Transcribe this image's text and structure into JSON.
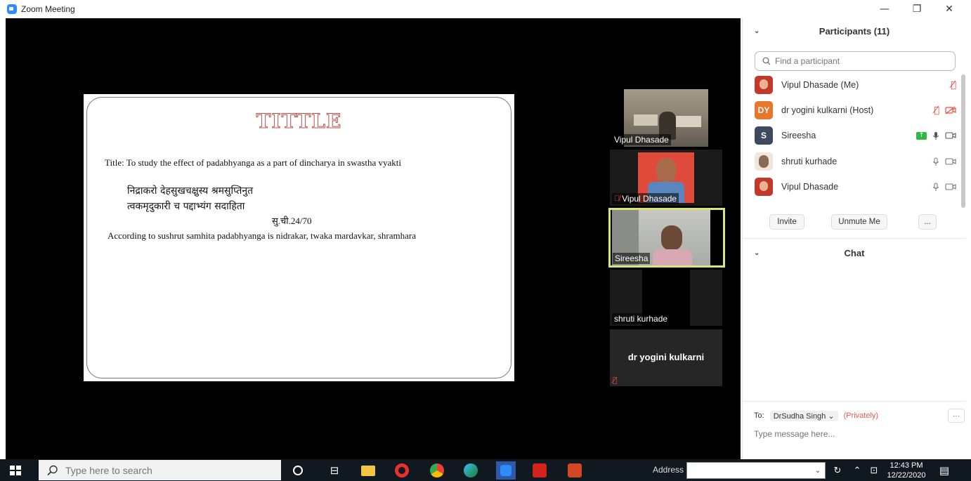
{
  "window": {
    "title": "Zoom Meeting",
    "minimize": "—",
    "restore": "❐",
    "close": "✕"
  },
  "slide": {
    "heading": "TITTLE",
    "line1": "Title: To study the effect of padabhyanga as a part of dincharya in swastha vyakti",
    "verse1": "निद्राकरो देहसुखचक्षुस्य श्रमसुप्तिनुत",
    "verse2": "त्वकमृदुकारी च पद्दाभ्यंग सदाहिता",
    "reference": "सु.ची.24/70",
    "line2": "According to sushrut samhita padabhyanga is nidrakar, twaka mardavkar, shramhara"
  },
  "video_tiles": [
    {
      "name": "Vipul Dhasade",
      "muted": false,
      "active": false
    },
    {
      "name": "Vipul Dhasade",
      "muted": true,
      "active": false
    },
    {
      "name": "Sireesha",
      "muted": false,
      "active": true
    },
    {
      "name": "shruti kurhade",
      "muted": false,
      "active": false
    },
    {
      "name": "dr yogini kulkarni",
      "muted": true,
      "active": false
    }
  ],
  "participants_panel": {
    "title": "Participants (11)",
    "search_placeholder": "Find a participant",
    "participants": [
      {
        "name": "Vipul Dhasade (Me)",
        "initials": "",
        "avatar_color": "#c0392b",
        "mic": "muted",
        "video": "none"
      },
      {
        "name": "dr yogini kulkarni (Host)",
        "initials": "DY",
        "avatar_color": "#e8772e",
        "mic": "muted",
        "video": "off"
      },
      {
        "name": "Sireesha",
        "initials": "S",
        "avatar_color": "#3b4a5c",
        "mic": "on",
        "video": "on",
        "share": true
      },
      {
        "name": "shruti kurhade",
        "initials": "",
        "avatar_color": "#8a6a50",
        "mic": "on",
        "video": "on"
      },
      {
        "name": "Vipul Dhasade",
        "initials": "",
        "avatar_color": "#c0392b",
        "mic": "on",
        "video": "on"
      }
    ],
    "buttons": {
      "invite": "Invite",
      "unmute": "Unmute Me",
      "more": "..."
    }
  },
  "chat": {
    "title": "Chat",
    "to_label": "To:",
    "recipient": "DrSudha Singh",
    "privately": "(Privately)",
    "more": "···",
    "placeholder": "Type message here..."
  },
  "taskbar": {
    "search_placeholder": "Type here to search",
    "address_label": "Address",
    "time": "12:43 PM",
    "date": "12/22/2020"
  }
}
